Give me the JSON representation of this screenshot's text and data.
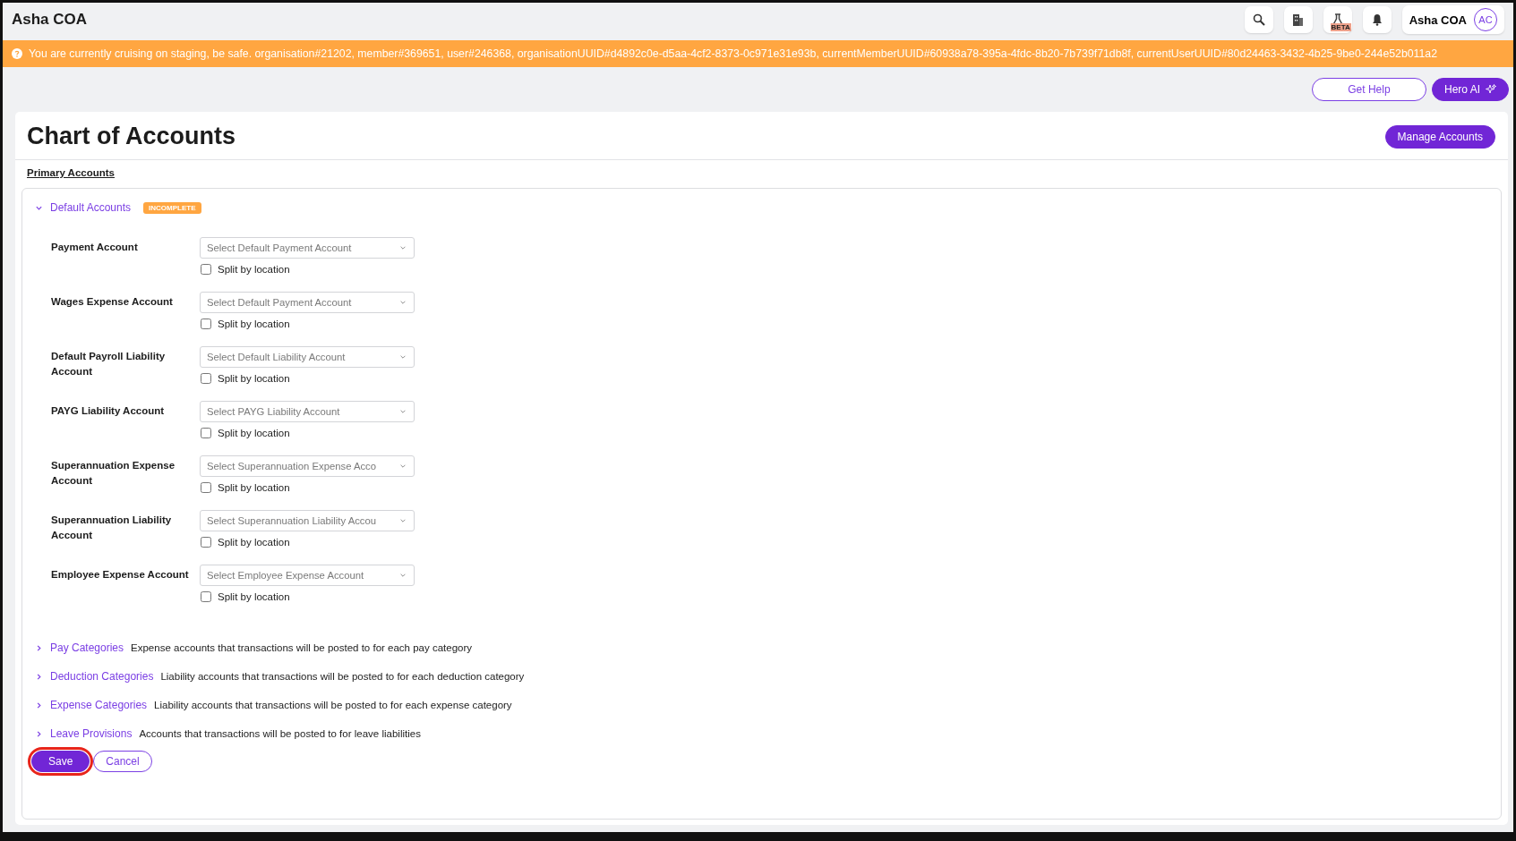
{
  "app_title": "Asha COA",
  "top_actions": [
    {
      "kind": "search"
    },
    {
      "kind": "building"
    },
    {
      "kind": "flask",
      "badge": "BETA"
    },
    {
      "kind": "bell"
    }
  ],
  "user": {
    "name": "Asha COA",
    "initials": "AC"
  },
  "banner": "You are currently cruising on staging, be safe. organisation#21202, member#369651, user#246368, organisationUUID#d4892c0e-d5aa-4cf2-8373-0c971e31e93b, currentMemberUUID#60938a78-395a-4fdc-8b20-7b739f71db8f, currentUserUUID#80d24463-3432-4b25-9be0-244e52b011a2",
  "help_buttons": [
    {
      "label": "Get Help",
      "kind": "outline"
    },
    {
      "label": "Hero AI",
      "kind": "ai"
    }
  ],
  "page_title": "Chart of Accounts",
  "manage_button": "Manage Accounts",
  "primary_link": "Primary Accounts",
  "default_section": {
    "title": "Default Accounts",
    "expanded": true,
    "status": "INCOMPLETE",
    "fields": [
      {
        "label": "Payment Account",
        "placeholder": "Select Default Payment Account",
        "split_label": "Split by location",
        "checked": false
      },
      {
        "label": "Wages Expense Account",
        "placeholder": "Select Default Payment Account",
        "split_label": "Split by location",
        "checked": false
      },
      {
        "label": "Default Payroll Liability Account",
        "placeholder": "Select Default Liability Account",
        "split_label": "Split by location",
        "checked": false
      },
      {
        "label": "PAYG Liability Account",
        "placeholder": "Select PAYG Liability Account",
        "split_label": "Split by location",
        "checked": false
      },
      {
        "label": "Superannuation Expense Account",
        "placeholder": "Select Superannuation Expense Acco",
        "split_label": "Split by location",
        "checked": false
      },
      {
        "label": "Superannuation Liability Account",
        "placeholder": "Select Superannuation Liability Accou",
        "split_label": "Split by location",
        "checked": false
      },
      {
        "label": "Employee Expense Account",
        "placeholder": "Select Employee Expense Account",
        "split_label": "Split by location",
        "checked": false
      }
    ]
  },
  "collapsed_sections": [
    {
      "title": "Pay Categories",
      "description": "Expense accounts that transactions will be posted to for each pay category",
      "expanded": false
    },
    {
      "title": "Deduction Categories",
      "description": "Liability accounts that transactions will be posted to for each deduction category",
      "expanded": false
    },
    {
      "title": "Expense Categories",
      "description": "Liability accounts that transactions will be posted to for each expense category",
      "expanded": false
    },
    {
      "title": "Leave Provisions",
      "description": "Accounts that transactions will be posted to for leave liabilities",
      "expanded": false
    }
  ],
  "form_buttons": [
    {
      "label": "Save",
      "kind": "primary",
      "focused": true
    },
    {
      "label": "Cancel",
      "kind": "outline",
      "focused": false
    }
  ]
}
